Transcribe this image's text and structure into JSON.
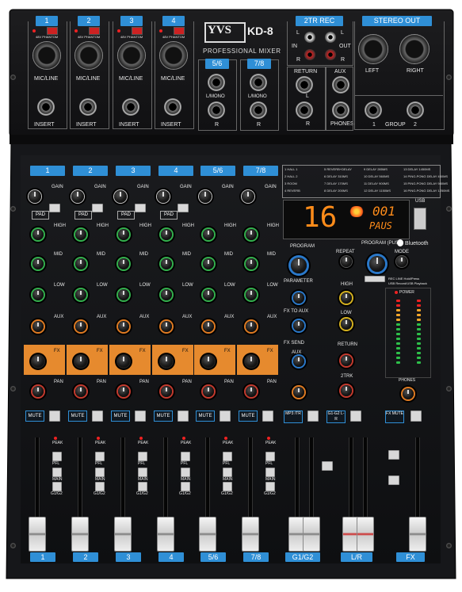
{
  "brand": {
    "logo": "YVS",
    "model": "KD-8",
    "subtitle": "PROFESSIONAL MIXER"
  },
  "top_panel": {
    "channels": [
      "1",
      "2",
      "3",
      "4"
    ],
    "phantom_label": "48V PHANTOM",
    "micline_label": "MIC/LINE",
    "insert_label": "INSERT",
    "stereo_inputs": [
      "5/6",
      "7/8"
    ],
    "lmono_label": "L/MONO",
    "r_label": "R",
    "tr_rec_title": "2TR REC",
    "tr_l": "L",
    "tr_r": "R",
    "tr_in": "IN",
    "tr_out": "OUT",
    "return_label": "RETURN",
    "aux_label": "AUX",
    "phones_label": "PHONES",
    "stereo_out_title": "STEREO OUT",
    "left_label": "LEFT",
    "right_label": "RIGHT",
    "group_labels": [
      "1",
      "GROUP",
      "2"
    ]
  },
  "channel_strip": {
    "labels": [
      "1",
      "2",
      "3",
      "4",
      "5/6",
      "7/8"
    ],
    "gain": "GAIN",
    "pad": "PAD",
    "high": "HIGH",
    "mid": "MID",
    "low": "LOW",
    "aux": "AUX",
    "fx": "FX",
    "pan": "PAN",
    "mute": "MUTE",
    "peak": "PEAK",
    "pfl": "PFL",
    "main": "MAIN",
    "group": "G1/G2"
  },
  "effects_list": [
    [
      "1 HALL 1",
      "5 REVERB+DELAY",
      "9 DELAY 285MS",
      "13 DELAY 1450MS"
    ],
    [
      "2 HALL 2",
      "6 DELAY 310MS",
      "10 DELAY 560MS",
      "14 PING-PONG DELAY 450MS"
    ],
    [
      "3 ROOM",
      "7 DELAY 170MS",
      "11 DELAY 900MS",
      "15 PING-PONG DELAY 980MS"
    ],
    [
      "4 REVERB",
      "8 DELAY 200MS",
      "12 DELAY 1150MS",
      "16 PING-PONG DELAY 1250MS"
    ]
  ],
  "display": {
    "program_number": "16",
    "track": "001",
    "status": "PAUS",
    "usb_label": "USB"
  },
  "master_section": {
    "program": "PROGRAM",
    "parameter": "PARAMETER",
    "program_push": "PROGRAM (PUSH)",
    "repeat": "REPEAT",
    "mode": "MODE",
    "bluetooth": "Bluetooth",
    "rec_label": "REC LINE Hold/Press",
    "usb_rec_label": "USB Record/USB Playback",
    "fx_to_aux": "FX TO AUX",
    "fx_send": "FX SEND",
    "aux": "AUX",
    "high": "HIGH",
    "low": "LOW",
    "return": "RETURN",
    "tr_2": "2TRK",
    "phones": "PHONES",
    "power": "POWER",
    "mp3_mute": "MP3 /TR",
    "g1g2_lr": "G1-G2 L-R",
    "fx_mute": "FX MUTE"
  },
  "bottom_labels": [
    "1",
    "2",
    "3",
    "4",
    "5/6",
    "7/8",
    "G1/G2",
    "L/R",
    "FX"
  ]
}
